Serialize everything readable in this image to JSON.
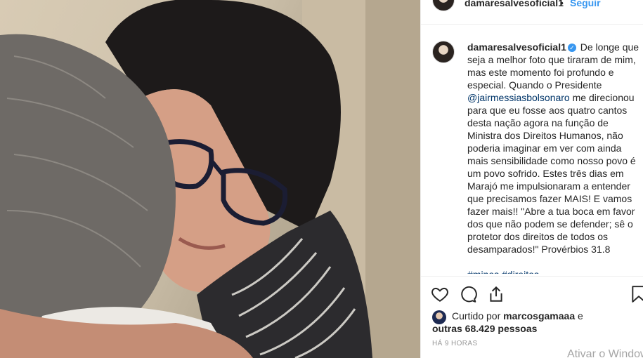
{
  "post": {
    "photo_alt": "",
    "header": {
      "username": "damaresalvesoficial1",
      "dot": "•",
      "follow_label": "Seguir"
    },
    "caption": {
      "username": "damaresalvesoficial1",
      "text_before_mention": "De longe que seja a melhor foto que tiraram de mim, mas este momento foi profundo e especial. Quando o Presidente ",
      "mention": "@jairmessiasbolsonaro",
      "text_after_mention": " me direcionou para que eu fosse aos quatro cantos desta nação agora na função de Ministra dos Direitos Humanos, não poderia imaginar em ver com ainda mais sensibilidade como nosso povo é um povo sofrido. Estes três dias em Marajó me impulsionaram a entender que precisamos fazer MAIS! E vamos fazer mais!! \"Abre a tua boca em favor dos que não podem se defender; sê o protetor dos direitos de todos os desamparados!\" Provérbios 31.8",
      "hashtags_peek": "#minos #direitos"
    },
    "likes": {
      "prefix": "Curtido por",
      "liker": "marcosgamaaa",
      "joiner": "e",
      "others": "outras 68.429 pessoas"
    },
    "timestamp": "HÁ 9 HORAS",
    "icons": {
      "like": "heart-icon",
      "comment": "comment-icon",
      "share": "share-icon",
      "save": "bookmark-icon"
    }
  },
  "os_watermark": "Ativar o Windows"
}
